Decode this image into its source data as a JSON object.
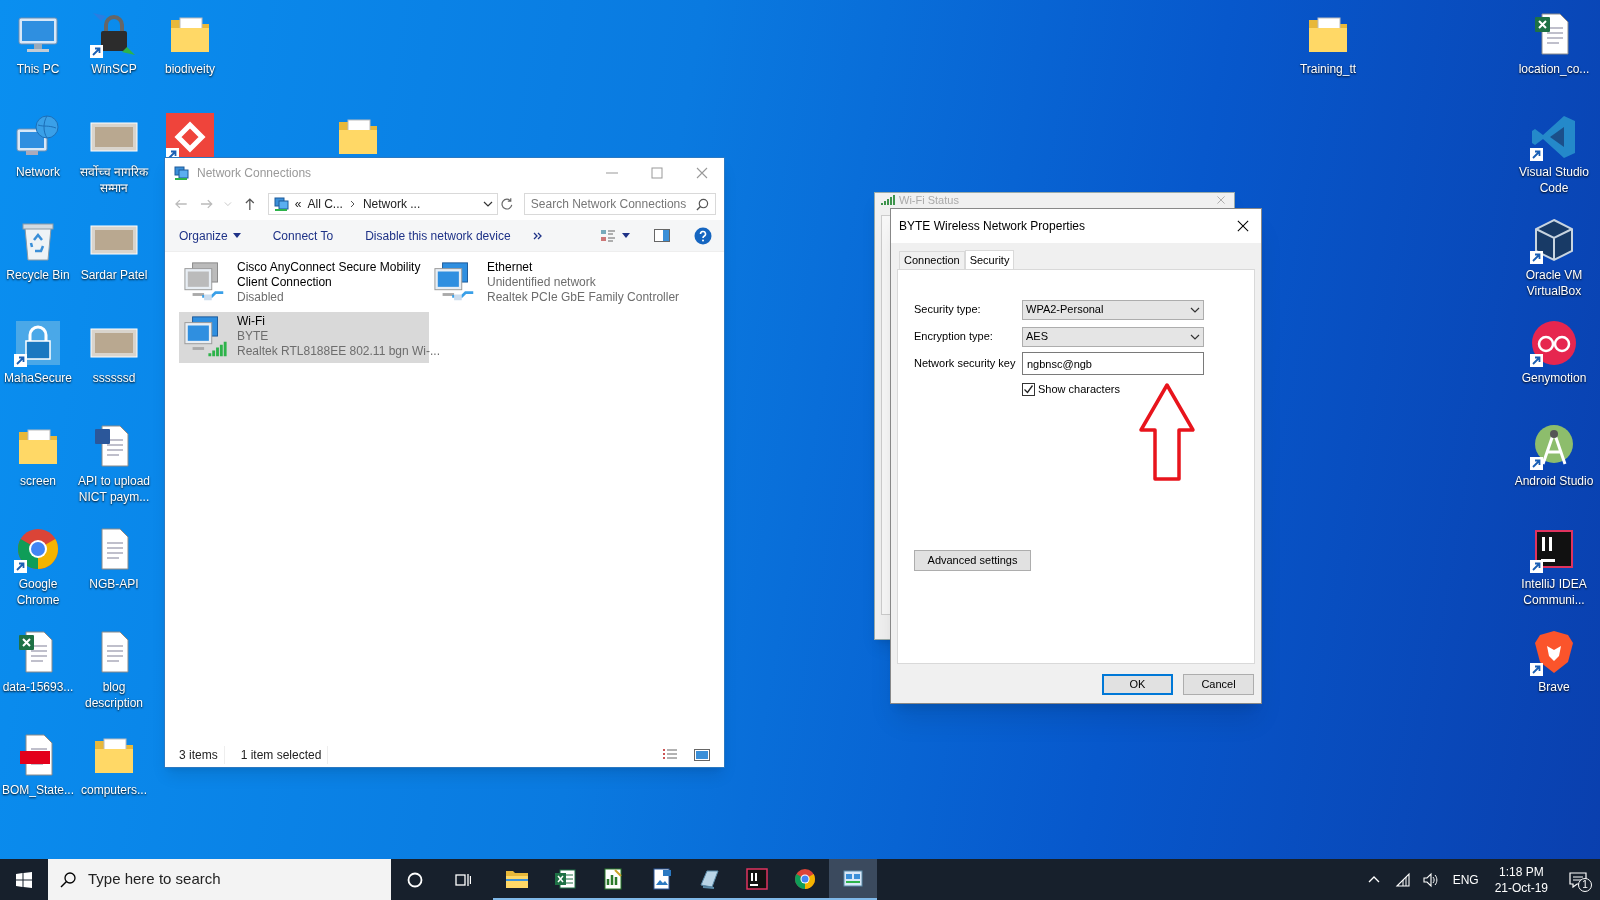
{
  "desktop": {
    "icons_left": [
      {
        "label": "This PC",
        "kind": "pc",
        "shortcut": false
      },
      {
        "label": "Network",
        "kind": "network",
        "shortcut": false
      },
      {
        "label": "Recycle Bin",
        "kind": "recycle",
        "shortcut": false
      },
      {
        "label": "MahaSecure",
        "kind": "lock",
        "shortcut": true
      },
      {
        "label": "screen",
        "kind": "folder",
        "shortcut": false
      },
      {
        "label": "Google Chrome",
        "kind": "chrome",
        "shortcut": true
      },
      {
        "label": "data-15693...",
        "kind": "excel-doc",
        "shortcut": false
      },
      {
        "label": "BOM_State...",
        "kind": "pdf",
        "shortcut": false
      },
      {
        "label": "WinSCP",
        "kind": "winscp",
        "shortcut": true
      },
      {
        "label": "सर्वोच्च नागरिक सम्मान",
        "kind": "photo",
        "shortcut": false
      },
      {
        "label": "Sardar Patel",
        "kind": "photo",
        "shortcut": false
      },
      {
        "label": "ssssssd",
        "kind": "photo",
        "shortcut": false
      },
      {
        "label": "API to upload NICT paym...",
        "kind": "word-doc",
        "shortcut": false
      },
      {
        "label": "NGB-API",
        "kind": "text-doc",
        "shortcut": false
      },
      {
        "label": "blog description",
        "kind": "text-doc",
        "shortcut": false
      },
      {
        "label": "computers...",
        "kind": "folder",
        "shortcut": false
      },
      {
        "label": "biodiveity",
        "kind": "folder",
        "shortcut": false
      },
      {
        "kind": "anydesk",
        "shortcut": true
      }
    ],
    "icon_behind_window": {
      "kind": "folder",
      "shortcut": false
    },
    "icon_top": {
      "label": "Training_tt",
      "kind": "folder",
      "shortcut": false
    },
    "icons_right": [
      {
        "label": "location_co...",
        "kind": "excel-doc",
        "shortcut": false
      },
      {
        "label": "Visual Studio Code",
        "kind": "vscode",
        "shortcut": true
      },
      {
        "label": "Oracle VM VirtualBox",
        "kind": "virtualbox",
        "shortcut": true
      },
      {
        "label": "Genymotion",
        "kind": "genymotion",
        "shortcut": true
      },
      {
        "label": "Android Studio",
        "kind": "android",
        "shortcut": true
      },
      {
        "label": "IntelliJ IDEA Communi...",
        "kind": "intellij",
        "shortcut": true
      },
      {
        "label": "Brave",
        "kind": "brave",
        "shortcut": true
      }
    ]
  },
  "network_connections": {
    "title": "Network Connections",
    "address": [
      "«",
      "All C...",
      "Network ..."
    ],
    "search": {
      "placeholder": "Search Network Connections"
    },
    "toolbar": [
      "Organize",
      "Connect To",
      "Disable this network device"
    ],
    "items": [
      {
        "name": "Cisco AnyConnect Secure Mobility Client Connection",
        "status": "Disabled",
        "kind": "vpn",
        "selected": false
      },
      {
        "name": "Ethernet",
        "status": "Unidentified network",
        "device": "Realtek PCIe GbE Family Controller",
        "kind": "ethernet",
        "selected": false
      },
      {
        "name": "Wi-Fi",
        "status": "BYTE",
        "device": "Realtek RTL8188EE 802.11 bgn Wi-...",
        "kind": "wifi",
        "selected": true
      }
    ],
    "status_bar": [
      "3 items",
      "1 item selected"
    ]
  },
  "wifi_status": {
    "title": "Wi-Fi Status"
  },
  "properties": {
    "title": "BYTE Wireless Network Properties",
    "tabs": [
      {
        "label": "Connection",
        "selected": false
      },
      {
        "label": "Security",
        "selected": true
      }
    ],
    "fields": [
      {
        "label": "Security type:",
        "kind": "dropdown",
        "value": "WPA2-Personal"
      },
      {
        "label": "Encryption type:",
        "kind": "dropdown",
        "value": "AES"
      },
      {
        "label": "Network security key",
        "kind": "text",
        "value": "ngbnsc@ngb"
      }
    ],
    "show_characters": {
      "label": "Show characters",
      "checked": true
    },
    "advanced_button": "Advanced settings",
    "buttons": [
      "OK",
      "Cancel"
    ]
  },
  "taskbar": {
    "search": {
      "placeholder": "Type here to search"
    },
    "apps": [
      {
        "kind": "explorer",
        "active": false
      },
      {
        "kind": "excel",
        "active": false
      },
      {
        "kind": "chart",
        "active": false
      },
      {
        "kind": "image",
        "active": false
      },
      {
        "kind": "slate",
        "active": false
      },
      {
        "kind": "intellij",
        "active": false
      },
      {
        "kind": "chrome",
        "active": false
      },
      {
        "kind": "network",
        "active": true
      }
    ],
    "language": "ENG",
    "time": "1:18 PM",
    "date": "21-Oct-19",
    "notifications": "1"
  }
}
